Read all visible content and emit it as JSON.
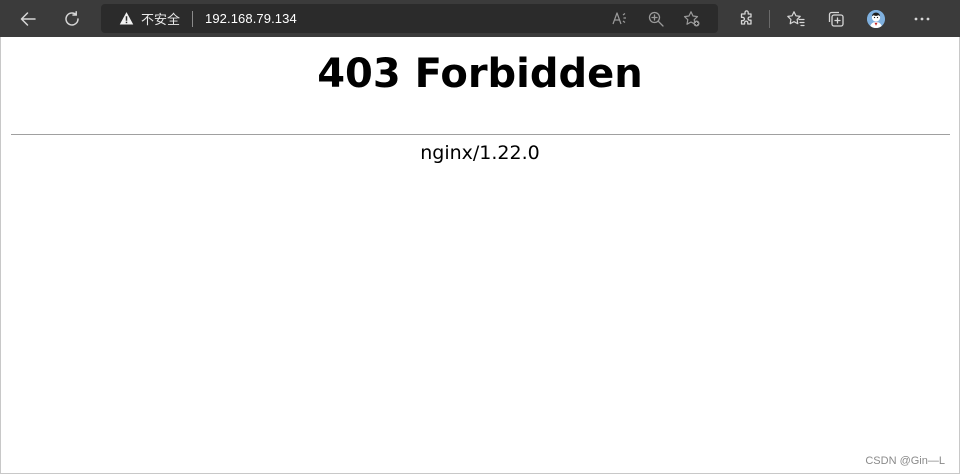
{
  "browser": {
    "security_label": "不安全",
    "url": "192.168.79.134",
    "icons": {
      "back": "arrow-left-icon",
      "refresh": "refresh-icon",
      "warning": "warning-triangle-icon",
      "read_aloud": "read-aloud-icon",
      "zoom": "zoom-in-icon",
      "favorite_add": "favorite-add-icon",
      "extensions": "extensions-icon",
      "favorites": "favorites-icon",
      "collections": "collections-icon",
      "profile": "avatar",
      "more": "more-icon"
    },
    "colors": {
      "toolbar_bg": "#3b3b3b",
      "address_bg": "#2b2b2b"
    }
  },
  "page": {
    "title": "403 Forbidden",
    "server": "nginx/1.22.0"
  },
  "watermark": "CSDN @Gin—L"
}
